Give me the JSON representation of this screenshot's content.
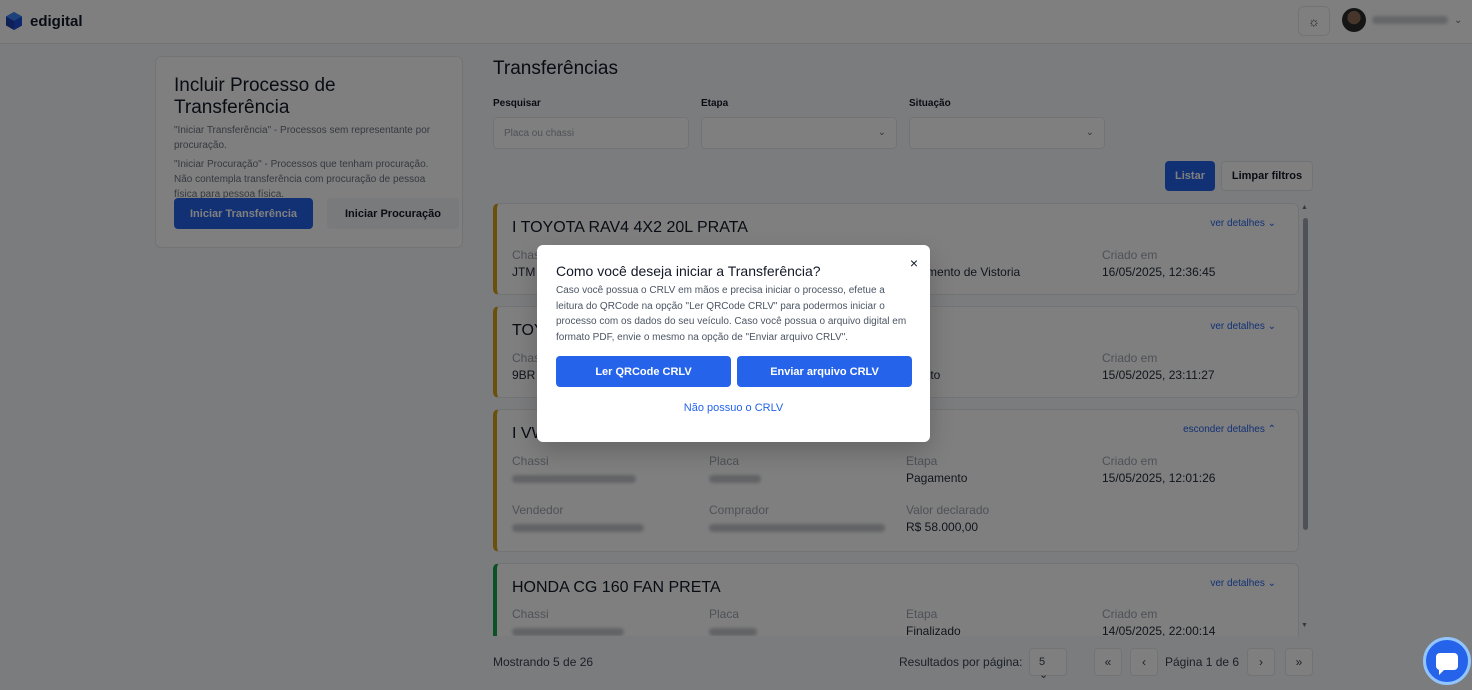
{
  "header": {
    "brand": "edigital",
    "theme_icon": "sun-icon",
    "user_chevron": "⌄"
  },
  "include_card": {
    "title": "Incluir Processo de Transferência",
    "desc1": "\"Iniciar Transferência\" - Processos sem representante por procuração.",
    "desc2": "\"Iniciar Procuração\" - Processos que tenham procuração. Não contempla transferência com procuração de pessoa física para pessoa física.",
    "btn_transfer": "Iniciar Transferência",
    "btn_procuracao": "Iniciar Procuração"
  },
  "main": {
    "title": "Transferências",
    "filters": {
      "search_label": "Pesquisar",
      "search_placeholder": "Placa ou chassi",
      "stage_label": "Etapa",
      "status_label": "Situação"
    },
    "list_button": "Listar",
    "clear_button": "Limpar filtros"
  },
  "labels": {
    "chassi": "Chassi",
    "placa": "Placa",
    "etapa": "Etapa",
    "criado": "Criado em",
    "vendedor": "Vendedor",
    "comprador": "Comprador",
    "valor": "Valor declarado"
  },
  "cards": [
    {
      "title": "I TOYOTA RAV4 4X2 20L PRATA",
      "toggle": "ver detalhes",
      "chassi_partial": "Chas",
      "chassi_val": "JTM",
      "etapa_val": "ndamento de Vistoria",
      "criado": "16/05/2025, 12:36:45",
      "status_color": "#d4a017"
    },
    {
      "title": "TOY",
      "toggle": "ver detalhes",
      "chassi_partial": "Chas",
      "chassi_val": "9BR",
      "etapa_partial": "a",
      "etapa_val": "mento",
      "criado": "15/05/2025, 23:11:27",
      "status_color": "#d4a017"
    },
    {
      "title": "I VW",
      "toggle": "esconder detalhes",
      "etapa_val": "Pagamento",
      "criado": "15/05/2025, 12:01:26",
      "valor": "R$ 58.000,00",
      "status_color": "#d4a017"
    },
    {
      "title": "HONDA CG 160 FAN PRETA",
      "toggle": "ver detalhes",
      "etapa_val": "Finalizado",
      "criado": "14/05/2025, 22:00:14",
      "status_color": "#16a34a"
    }
  ],
  "footer": {
    "showing": "Mostrando 5 de 26",
    "per_page_label": "Resultados por página:",
    "per_page_value": "5",
    "page_text": "Página 1 de 6",
    "first": "«",
    "prev": "‹",
    "next": "›",
    "last": "»"
  },
  "modal": {
    "title": "Como você deseja iniciar a Transferência?",
    "text": "Caso você possua o CRLV em mãos e precisa iniciar o processo, efetue a leitura do QRCode na opção \"Ler QRCode CRLV\" para podermos iniciar o processo com os dados do seu veículo. Caso você possua o arquivo digital em formato PDF, envie o mesmo na opção de \"Enviar arquivo CRLV\".",
    "btn_qrcode": "Ler QRCode CRLV",
    "btn_upload": "Enviar arquivo CRLV",
    "link_no_crlv": "Não possuo o CRLV",
    "close": "×"
  },
  "colors": {
    "primary": "#2563eb",
    "pending": "#d4a017",
    "done": "#16a34a"
  }
}
